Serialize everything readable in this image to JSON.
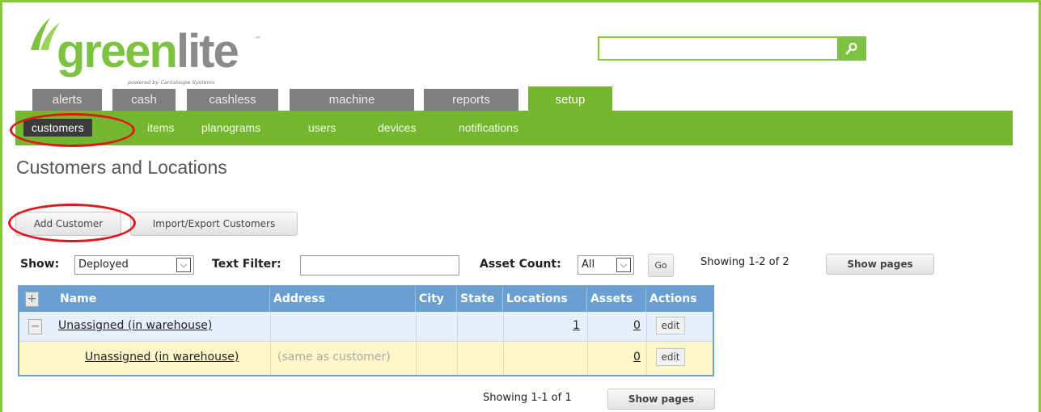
{
  "brand": {
    "logo_text_green": "green",
    "logo_text_gray": "lite",
    "powered_by": "powered by Cantaloupe Systems",
    "accent": "#74b72e"
  },
  "search": {
    "value": "",
    "icon": "search-icon"
  },
  "tabs": [
    {
      "label": "alerts"
    },
    {
      "label": "cash"
    },
    {
      "label": "cashless"
    },
    {
      "label": "machine"
    },
    {
      "label": "reports"
    },
    {
      "label": "setup",
      "active": true
    }
  ],
  "subnav": [
    {
      "label": "customers",
      "active": true
    },
    {
      "label": "items"
    },
    {
      "label": "planograms"
    },
    {
      "label": "users"
    },
    {
      "label": "devices"
    },
    {
      "label": "notifications"
    }
  ],
  "page": {
    "title": "Customers and Locations",
    "add_customer": "Add Customer",
    "import_export": "Import/Export Customers"
  },
  "filters": {
    "show_label": "Show:",
    "show_value": "Deployed",
    "text_filter_label": "Text Filter:",
    "text_filter_value": "",
    "asset_count_label": "Asset Count:",
    "asset_count_value": "All",
    "go": "Go",
    "showing_top": "Showing 1-2 of 2",
    "show_pages": "Show pages"
  },
  "table": {
    "expand_all": "+",
    "columns": [
      "Name",
      "Address",
      "City",
      "State",
      "Locations",
      "Assets",
      "Actions"
    ],
    "rows": [
      {
        "toggle": "−",
        "name": "Unassigned (in warehouse)",
        "address": "",
        "city": "",
        "state": "",
        "locations": "1",
        "assets": "0",
        "action": "edit"
      },
      {
        "toggle": "",
        "name": "Unassigned (in warehouse)",
        "address": "(same as customer)",
        "city": "",
        "state": "",
        "locations": "",
        "assets": "0",
        "action": "edit"
      }
    ]
  },
  "footer": {
    "showing_bottom": "Showing 1-1 of 1",
    "show_pages": "Show pages"
  }
}
